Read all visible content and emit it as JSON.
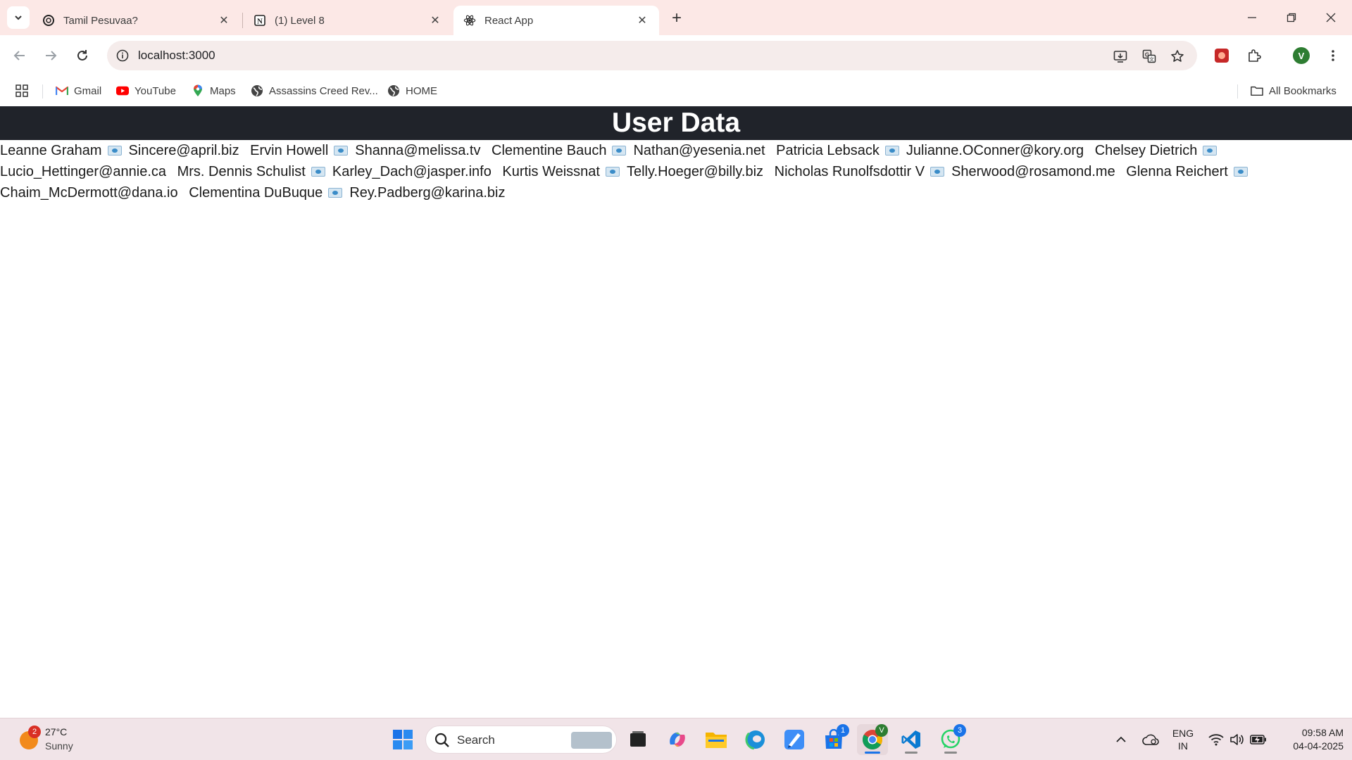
{
  "browser": {
    "tabs": [
      {
        "title": "Tamil Pesuvaa?",
        "favicon": "openai-icon",
        "active": false
      },
      {
        "title": "(1) Level 8",
        "favicon": "notion-icon",
        "active": false
      },
      {
        "title": "React App",
        "favicon": "react-icon",
        "active": true
      }
    ],
    "url": "localhost:3000",
    "bookmarks": [
      {
        "label": "Gmail",
        "icon": "gmail-icon"
      },
      {
        "label": "YouTube",
        "icon": "youtube-icon"
      },
      {
        "label": "Maps",
        "icon": "maps-icon"
      },
      {
        "label": "Assassins Creed Rev...",
        "icon": "globe-icon"
      },
      {
        "label": "HOME",
        "icon": "globe-icon"
      }
    ],
    "all_bookmarks_label": "All Bookmarks",
    "profile_initial": "V"
  },
  "page": {
    "heading": "User Data",
    "users": [
      {
        "name": "Leanne Graham",
        "email": "Sincere@april.biz"
      },
      {
        "name": "Ervin Howell",
        "email": "Shanna@melissa.tv"
      },
      {
        "name": "Clementine Bauch",
        "email": "Nathan@yesenia.net"
      },
      {
        "name": "Patricia Lebsack",
        "email": "Julianne.OConner@kory.org"
      },
      {
        "name": "Chelsey Dietrich",
        "email": "Lucio_Hettinger@annie.ca"
      },
      {
        "name": "Mrs. Dennis Schulist",
        "email": "Karley_Dach@jasper.info"
      },
      {
        "name": "Kurtis Weissnat",
        "email": "Telly.Hoeger@billy.biz"
      },
      {
        "name": "Nicholas Runolfsdottir V",
        "email": "Sherwood@rosamond.me"
      },
      {
        "name": "Glenna Reichert",
        "email": "Chaim_McDermott@dana.io"
      },
      {
        "name": "Clementina DuBuque",
        "email": "Rey.Padberg@karina.biz"
      }
    ]
  },
  "taskbar": {
    "weather": {
      "temp": "27°C",
      "condition": "Sunny",
      "badge": "2"
    },
    "search_placeholder": "Search",
    "badges": {
      "store": "1",
      "whatsapp": "3",
      "chrome_profile": "V"
    },
    "language": {
      "line1": "ENG",
      "line2": "IN"
    },
    "time": "09:58 AM",
    "date": "04-04-2025"
  },
  "colors": {
    "header_bg": "#20232a",
    "chrome_bg": "#fce8e6",
    "accent": "#1a73e8"
  }
}
